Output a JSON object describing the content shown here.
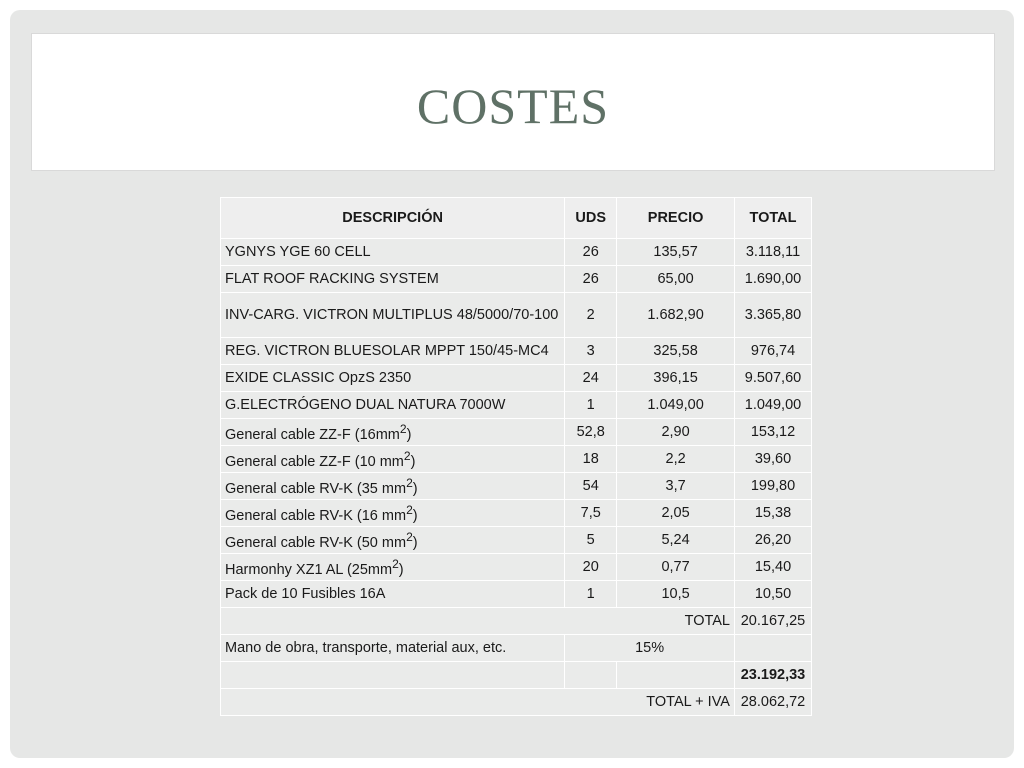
{
  "title": "COSTES",
  "headers": {
    "description": "DESCRIPCIÓN",
    "units": "UDS",
    "price": "PRECIO",
    "total": "TOTAL"
  },
  "rows": [
    {
      "desc": "YGNYS YGE 60 CELL",
      "uds": "26",
      "precio": "135,57",
      "total": "3.118,11"
    },
    {
      "desc": "FLAT ROOF RACKING SYSTEM",
      "uds": "26",
      "precio": "65,00",
      "total": "1.690,00"
    },
    {
      "desc": "INV-CARG. VICTRON MULTIPLUS 48/5000/70-100",
      "uds": "2",
      "precio": "1.682,90",
      "total": "3.365,80"
    },
    {
      "desc": "REG. VICTRON BLUESOLAR MPPT 150/45-MC4",
      "uds": "3",
      "precio": "325,58",
      "total": "976,74"
    },
    {
      "desc": "EXIDE CLASSIC OpzS 2350",
      "uds": "24",
      "precio": "396,15",
      "total": "9.507,60"
    },
    {
      "desc": "G.ELECTRÓGENO DUAL NATURA 7000W",
      "uds": "1",
      "precio": "1.049,00",
      "total": "1.049,00"
    },
    {
      "desc_pre": "General cable ZZ-F (16mm",
      "sup": "2",
      "desc_post": ")",
      "uds": "52,8",
      "precio": "2,90",
      "total": "153,12"
    },
    {
      "desc_pre": "General cable ZZ-F (10 mm",
      "sup": "2",
      "desc_post": ")",
      "uds": "18",
      "precio": "2,2",
      "total": "39,60"
    },
    {
      "desc_pre": "General cable RV-K (35 mm",
      "sup": "2",
      "desc_post": ")",
      "uds": "54",
      "precio": "3,7",
      "total": "199,80"
    },
    {
      "desc_pre": "General cable RV-K (16 mm",
      "sup": "2",
      "desc_post": ")",
      "uds": "7,5",
      "precio": "2,05",
      "total": "15,38"
    },
    {
      "desc_pre": "General cable RV-K (50 mm",
      "sup": "2",
      "desc_post": ")",
      "uds": "5",
      "precio": "5,24",
      "total": "26,20"
    },
    {
      "desc_pre": "Harmonhy XZ1 AL (25mm",
      "sup": "2",
      "desc_post": ")",
      "uds": "20",
      "precio": "0,77",
      "total": "15,40"
    },
    {
      "desc": "Pack de 10 Fusibles 16A",
      "uds": "1",
      "precio": "10,5",
      "total": "10,50"
    }
  ],
  "summary": {
    "total_label": "TOTAL",
    "total_value": "20.167,25",
    "labor_label": "Mano de obra, transporte, material aux, etc.",
    "labor_pct": "15%",
    "subtotal_value": "23.192,33",
    "iva_label": "TOTAL + IVA",
    "iva_value": "28.062,72"
  }
}
